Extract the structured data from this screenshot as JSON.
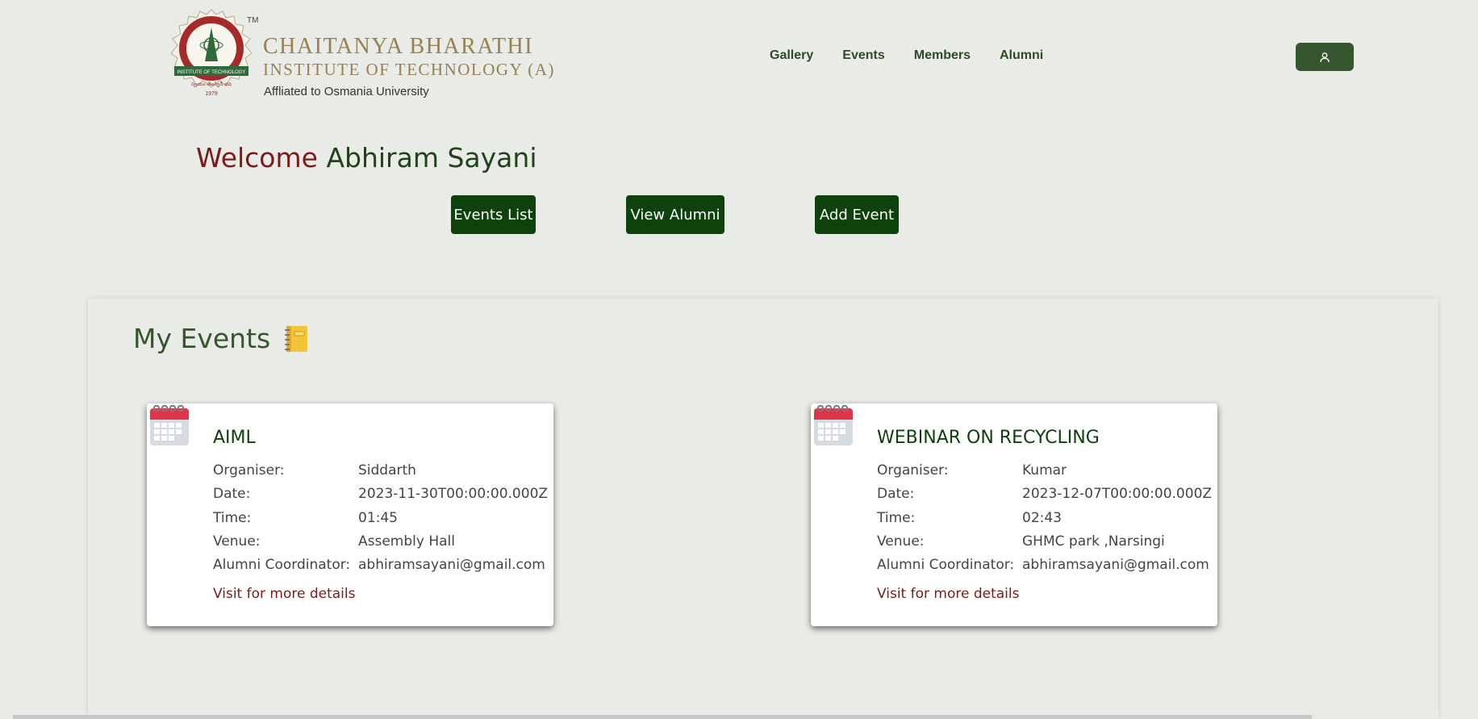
{
  "header": {
    "logo": {
      "line1": "CHAITANYA BHARATHI",
      "line2": "INSTITUTE OF TECHNOLOGY (A)",
      "line3": "Affliated to Osmania University",
      "tm": "TM",
      "seal_text_top": "CHAITANYA BHARATHI",
      "seal_band": "INSTITUTE OF TECHNOLOGY",
      "seal_year": "1979"
    },
    "nav": [
      "Gallery",
      "Events",
      "Members",
      "Alumni"
    ],
    "user_icon": "person-icon"
  },
  "welcome": {
    "greeting": "Welcome",
    "name": "Abhiram Sayani"
  },
  "actions": {
    "events_list": "Events List",
    "view_alumni": "View Alumni",
    "add_event": "Add Event"
  },
  "my_events": {
    "title": "My Events",
    "title_icon": "notebook-icon",
    "labels": {
      "organiser": "Organiser:",
      "date": "Date:",
      "time": "Time:",
      "venue": "Venue:",
      "coordinator": "Alumni Coordinator:"
    },
    "events": [
      {
        "title": "AIML",
        "organiser": "Siddarth",
        "date": "2023-11-30T00:00:00.000Z",
        "time": "01:45",
        "venue": "Assembly Hall",
        "coordinator": "abhiramsayani@gmail.com",
        "link": "Visit for more details"
      },
      {
        "title": "WEBINAR ON RECYCLING",
        "organiser": "Kumar",
        "date": "2023-12-07T00:00:00.000Z",
        "time": "02:43",
        "venue": "GHMC park ,Narsingi",
        "coordinator": "abhiramsayani@gmail.com",
        "link": "Visit for more details"
      }
    ]
  },
  "colors": {
    "background": "#e9ebe6",
    "primary_green": "#0d420d",
    "nav_green": "#2e4a27",
    "maroon": "#7b1c1c",
    "gold": "#9a7f4f"
  }
}
